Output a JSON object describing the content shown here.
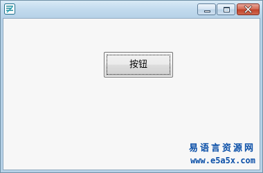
{
  "window": {
    "icon": "app-icon",
    "caption_buttons": [
      "minimize-icon",
      "maximize-icon",
      "close-icon"
    ]
  },
  "main": {
    "button_label": "按钮"
  },
  "watermark": {
    "line1": "易语言资源网",
    "line2": "www.e5a5x.com"
  },
  "colors": {
    "title_gradient_top": "#d9eaf6",
    "title_gradient_bottom": "#b6d1e7",
    "client_background": "#f7f7f7",
    "close_button": "#c0422a",
    "watermark_text": "#0a4fa8"
  }
}
